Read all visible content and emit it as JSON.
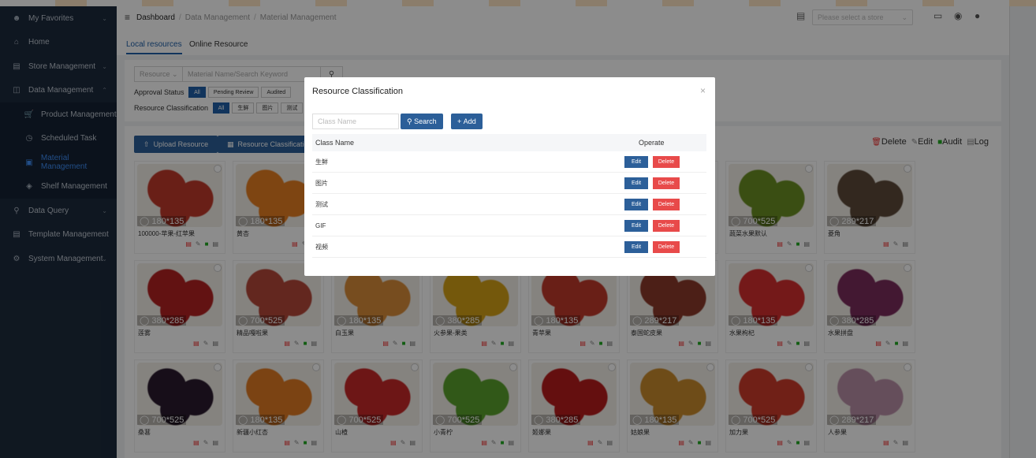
{
  "sidebar": {
    "items": [
      {
        "label": "My Favorites",
        "icon": "user-icon"
      },
      {
        "label": "Home",
        "icon": "home-icon"
      },
      {
        "label": "Store Management",
        "icon": "store-icon"
      },
      {
        "label": "Data Management",
        "icon": "database-icon"
      },
      {
        "label": "Product Management",
        "icon": "cart-icon"
      },
      {
        "label": "Scheduled Task",
        "icon": "clock-icon"
      },
      {
        "label": "Material Management",
        "icon": "image-icon"
      },
      {
        "label": "Shelf Management",
        "icon": "layers-icon"
      },
      {
        "label": "Data Query",
        "icon": "search-icon"
      },
      {
        "label": "Template Management",
        "icon": "file-icon"
      },
      {
        "label": "System Management",
        "icon": "gear-icon"
      }
    ]
  },
  "header": {
    "breadcrumb": [
      "Dashboard",
      "Data Management",
      "Material Management"
    ],
    "store_placeholder": "Please select a store"
  },
  "tabs": [
    "Local resources",
    "Online Resource"
  ],
  "filters": {
    "resource_select": "Resource",
    "search_placeholder": "Material Name/Search Keyword",
    "approval_label": "Approval Status",
    "approval_chips": [
      "All",
      "Pending Review",
      "Audited"
    ],
    "class_label": "Resource Classification",
    "class_chips": [
      "All",
      "生鲜",
      "图片",
      "测试"
    ]
  },
  "toolbar": {
    "upload": "Upload Resource",
    "classification": "Resource Classification",
    "ops": [
      "Delete",
      "Edit",
      "Audit",
      "Log"
    ]
  },
  "cards": [
    {
      "name": "100000-苹果-红苹果",
      "size": "180*135",
      "color": "#c0392b",
      "audit": true
    },
    {
      "name": "黄杏",
      "size": "180*135",
      "color": "#e67e22",
      "audit": false
    },
    {
      "name": "",
      "size": "",
      "color": "#888",
      "audit": true
    },
    {
      "name": "",
      "size": "",
      "color": "#888",
      "audit": true
    },
    {
      "name": "",
      "size": "",
      "color": "#888",
      "audit": true
    },
    {
      "name": "",
      "size": "",
      "color": "#888",
      "audit": true
    },
    {
      "name": "蔬菜水果默认",
      "size": "700*525",
      "color": "#6b8e23",
      "audit": true
    },
    {
      "name": "菱角",
      "size": "289*217",
      "color": "#5d4a3a",
      "audit": false
    },
    {
      "name": "莲雾",
      "size": "380*285",
      "color": "#b22222",
      "audit": false
    },
    {
      "name": "精品嘎啦果",
      "size": "700*525",
      "color": "#b5473a",
      "audit": true
    },
    {
      "name": "白玉果",
      "size": "180*135",
      "color": "#d98c3a",
      "audit": true
    },
    {
      "name": "火参果-果类",
      "size": "380*285",
      "color": "#d4a017",
      "audit": true
    },
    {
      "name": "青苹果",
      "size": "180*135",
      "color": "#c0392b",
      "audit": true
    },
    {
      "name": "泰国蛇皮果",
      "size": "289*217",
      "color": "#8b3a2a",
      "audit": true
    },
    {
      "name": "水果枸杞",
      "size": "180*135",
      "color": "#d32f2f",
      "audit": true
    },
    {
      "name": "水果拼盘",
      "size": "380*285",
      "color": "#7b2d5c",
      "audit": true
    },
    {
      "name": "桑葚",
      "size": "700*525",
      "color": "#2b1b2e",
      "audit": false
    },
    {
      "name": "新疆小红杏",
      "size": "180*135",
      "color": "#e07b24",
      "audit": true
    },
    {
      "name": "山楂",
      "size": "700*525",
      "color": "#c62828",
      "audit": false
    },
    {
      "name": "小青柠",
      "size": "700*525",
      "color": "#5aa02c",
      "audit": true
    },
    {
      "name": "姬娜果",
      "size": "380*285",
      "color": "#b71c1c",
      "audit": false
    },
    {
      "name": "姑娘果",
      "size": "180*135",
      "color": "#c98a2c",
      "audit": true
    },
    {
      "name": "加力果",
      "size": "700*525",
      "color": "#cc3b2b",
      "audit": true
    },
    {
      "name": "人参果",
      "size": "289*217",
      "color": "#b98ea6",
      "audit": false
    }
  ],
  "modal": {
    "title": "Resource Classification",
    "search_placeholder": "Class Name",
    "search_btn": "Search",
    "add_btn": "Add",
    "col_name": "Class Name",
    "col_operate": "Operate",
    "edit_label": "Edit",
    "delete_label": "Delete",
    "rows": [
      "生鲜",
      "图片",
      "测试",
      "GIF",
      "视频"
    ]
  }
}
